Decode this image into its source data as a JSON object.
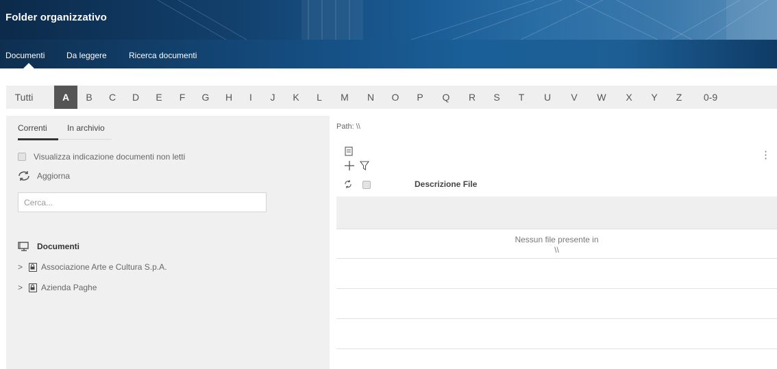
{
  "header": {
    "title": "Folder organizzativo"
  },
  "nav": {
    "items": [
      {
        "label": "Documenti",
        "active": true
      },
      {
        "label": "Da leggere"
      },
      {
        "label": "Ricerca documenti"
      }
    ]
  },
  "alphabet": {
    "items": [
      "Tutti",
      "A",
      "B",
      "C",
      "D",
      "E",
      "F",
      "G",
      "H",
      "I",
      "J",
      "K",
      "L",
      "M",
      "N",
      "O",
      "P",
      "Q",
      "R",
      "S",
      "T",
      "U",
      "V",
      "W",
      "X",
      "Y",
      "Z",
      "0-9"
    ],
    "active": "A"
  },
  "left": {
    "tabs": [
      {
        "label": "Correnti"
      },
      {
        "label": "In archivio"
      }
    ],
    "show_unread_label": "Visualizza indicazione documenti non letti",
    "refresh_label": "Aggiorna",
    "search_placeholder": "Cerca...",
    "tree": {
      "root_label": "Documenti",
      "items": [
        {
          "label": "Associazione Arte e Cultura S.p.A."
        },
        {
          "label": "Azienda Paghe"
        }
      ]
    }
  },
  "right": {
    "path_label": "Path: \\\\",
    "column_header": "Descrizione File",
    "empty_line1": "Nessun file presente in",
    "empty_line2": "\\\\",
    "more_label": "⋮"
  },
  "colors": {
    "banner_dark": "#0c2a4a",
    "banner_mid": "#1a5c95",
    "active_letter_bg": "#555555",
    "panel_bg": "#f0f0f0"
  }
}
